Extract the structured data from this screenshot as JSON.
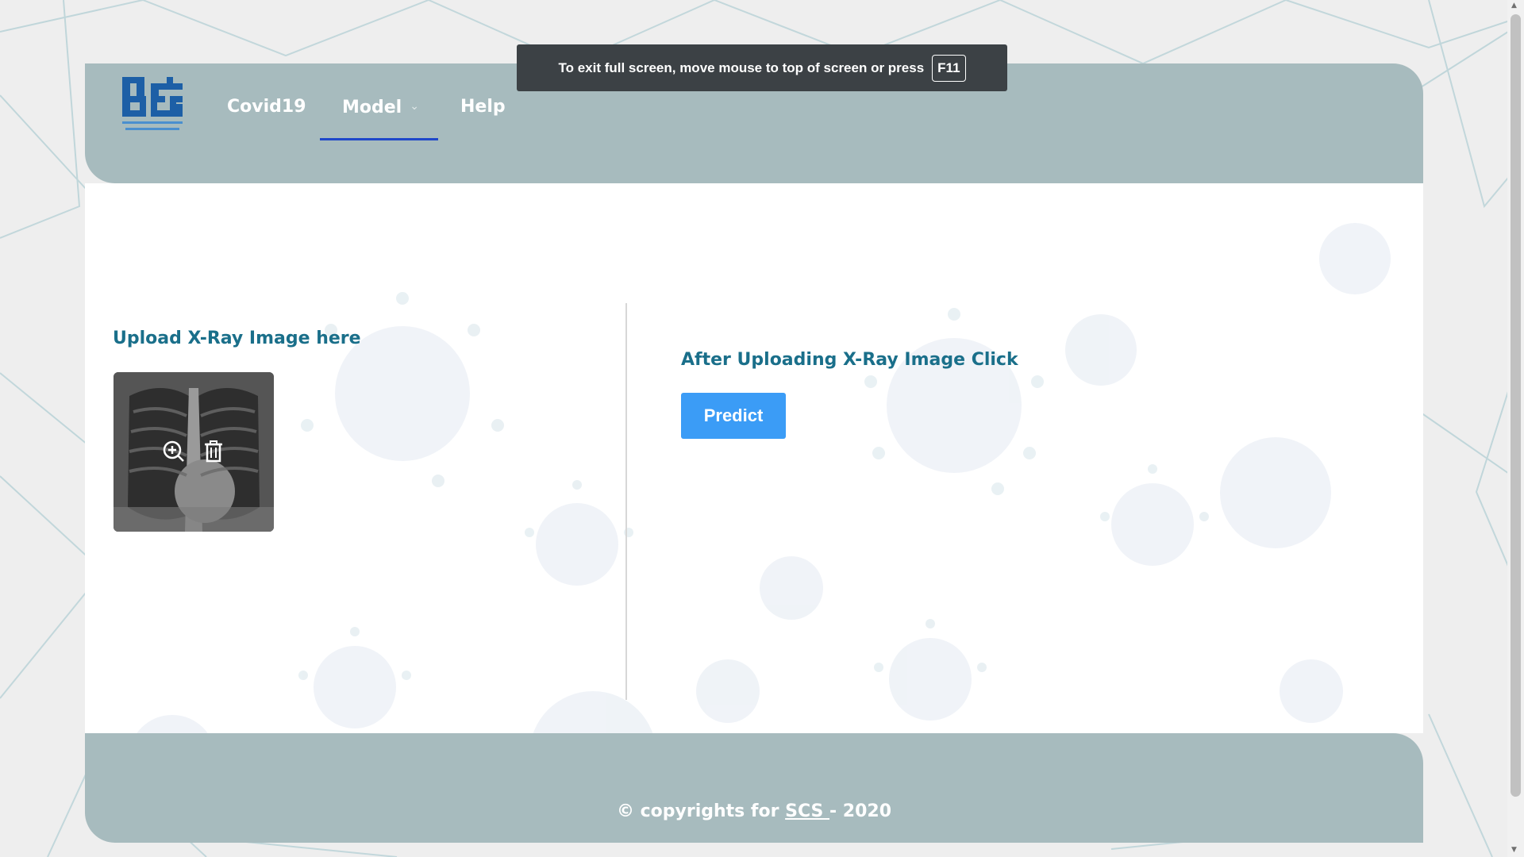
{
  "fullscreen_notice": {
    "message": "To exit full screen, move mouse to top of screen or press",
    "key": "F11"
  },
  "header": {
    "logo_icon": "scs-logo-icon",
    "nav": [
      {
        "label": "Covid19",
        "active": false
      },
      {
        "label": "Model",
        "active": true,
        "has_dropdown": true
      },
      {
        "label": "Help",
        "active": false
      }
    ]
  },
  "upload": {
    "title": "Upload X-Ray Image here",
    "preview_alt": "chest x-ray preview",
    "actions": [
      "zoom-in-icon",
      "trash-icon"
    ]
  },
  "predict": {
    "title": "After Uploading X-Ray Image Click",
    "button_label": "Predict"
  },
  "footer": {
    "prefix": "© copyrights for ",
    "link": "SCS ",
    "suffix": "- 2020"
  },
  "colors": {
    "header_bg": "#a7bbbe",
    "accent_text": "#1a6f8a",
    "button_bg": "#3b9cf6",
    "active_underline": "#1f47c9"
  }
}
